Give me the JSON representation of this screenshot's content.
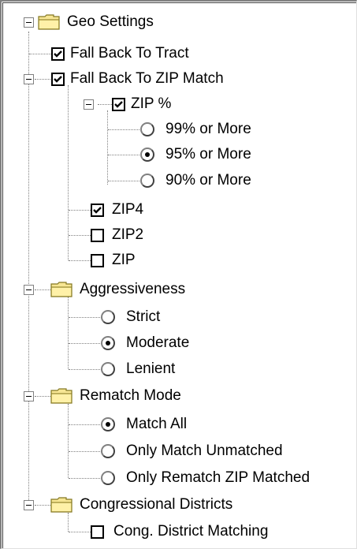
{
  "colors": {
    "folder_body": "#f7e694",
    "folder_edge": "#847821",
    "folder_tab": "#fff7c6",
    "line": "#808080"
  },
  "tree": {
    "geo_settings": {
      "label": "Geo Settings",
      "icon": "folder-icon",
      "expanded": true
    },
    "fall_back_to_tract": {
      "label": "Fall Back To Tract",
      "checked": true
    },
    "fall_back_to_zip_match": {
      "label": "Fall Back To ZIP Match",
      "checked": true,
      "expanded": true
    },
    "zip_percent": {
      "label": "ZIP %",
      "checked": true,
      "expanded": true
    },
    "zip_99": {
      "label": "99% or More",
      "selected": false
    },
    "zip_95": {
      "label": "95% or More",
      "selected": true
    },
    "zip_90": {
      "label": "90% or More",
      "selected": false
    },
    "zip4": {
      "label": "ZIP4",
      "checked": true
    },
    "zip2": {
      "label": "ZIP2",
      "checked": false
    },
    "zip": {
      "label": "ZIP",
      "checked": false
    },
    "aggressiveness": {
      "label": "Aggressiveness",
      "icon": "folder-icon",
      "expanded": true
    },
    "strict": {
      "label": "Strict",
      "selected": false
    },
    "moderate": {
      "label": "Moderate",
      "selected": true
    },
    "lenient": {
      "label": "Lenient",
      "selected": false
    },
    "rematch_mode": {
      "label": "Rematch Mode",
      "icon": "folder-icon",
      "expanded": true
    },
    "match_all": {
      "label": "Match All",
      "selected": true
    },
    "only_match_unmatched": {
      "label": "Only Match Unmatched",
      "selected": false
    },
    "only_rematch_zip_matched": {
      "label": "Only Rematch ZIP Matched",
      "selected": false
    },
    "congressional_districts": {
      "label": "Congressional Districts",
      "icon": "folder-icon",
      "expanded": true
    },
    "cong_district_matching": {
      "label": "Cong. District Matching",
      "checked": false
    }
  }
}
